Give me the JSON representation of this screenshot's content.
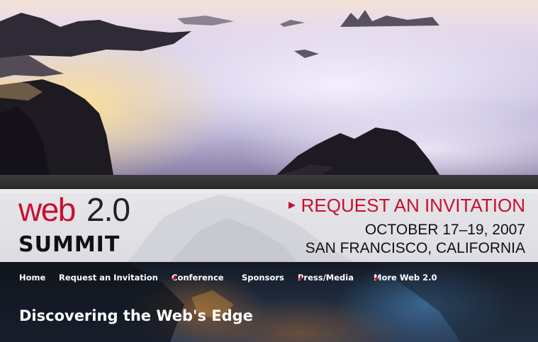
{
  "logo": {
    "word": "web",
    "version": "2.0",
    "subtitle": "SUMMIT"
  },
  "invitation": {
    "label": "REQUEST AN INVITATION",
    "icon": "triangle-right-icon",
    "color": "#c8102e"
  },
  "event": {
    "date": "OCTOBER 17–19, 2007",
    "location": "SAN FRANCISCO, CALIFORNIA"
  },
  "nav": {
    "items": [
      {
        "label": "Home",
        "has_menu": false
      },
      {
        "label": "Request an Invitation",
        "has_menu": false
      },
      {
        "label": "Conference",
        "has_menu": true
      },
      {
        "label": "Sponsors",
        "has_menu": false
      },
      {
        "label": "Press/Media",
        "has_menu": true
      },
      {
        "label": "More Web 2.0",
        "has_menu": true
      }
    ],
    "menu_icon": "caret-down-right-icon",
    "menu_icon_color": "#c8102e"
  },
  "tagline": "Discovering the Web's Edge",
  "colors": {
    "brand_red": "#c8102e",
    "banner_bg": "#e2e2e6",
    "nav_text": "#ffffff"
  }
}
